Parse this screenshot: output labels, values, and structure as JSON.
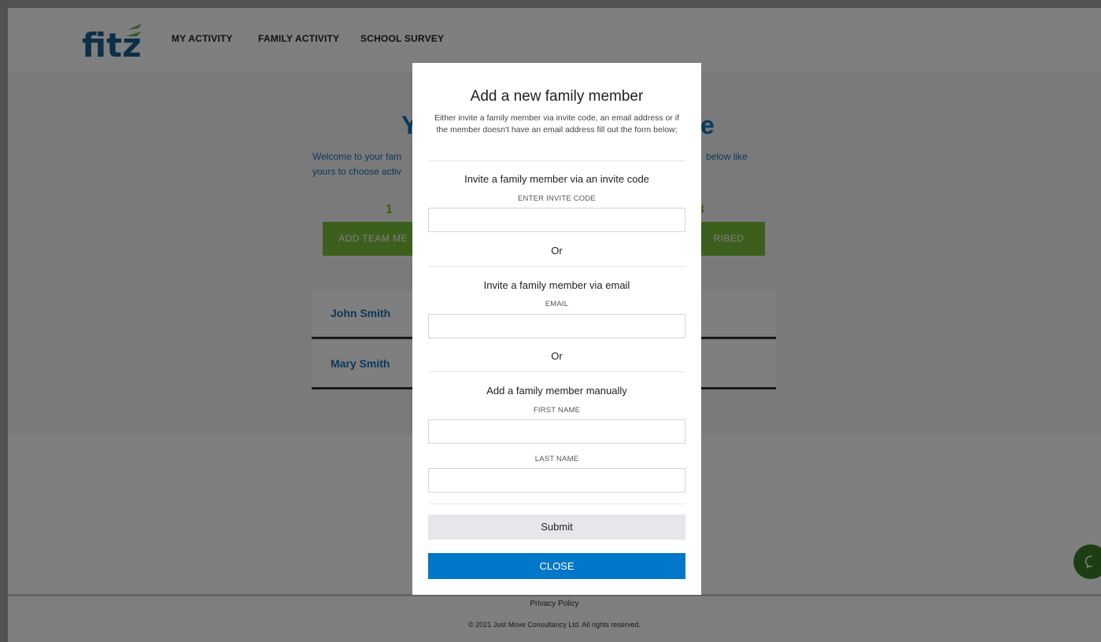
{
  "nav": {
    "logo_text": "fitz",
    "items": [
      {
        "label": "MY ACTIVITY"
      },
      {
        "label": "FAMILY ACTIVITY"
      },
      {
        "label": "SCHOOL SURVEY"
      }
    ]
  },
  "hero": {
    "title_left": "Y",
    "title_right": "e",
    "text_left_1": "Welcome to your fam",
    "text_left_2": "yours to choose activ",
    "text_right": "below like",
    "stat_left": "1",
    "stat_right": "3",
    "btn_left_label": "ADD TEAM ME",
    "btn_right_label": "RIBED"
  },
  "members": [
    {
      "name": "John Smith"
    },
    {
      "name": "Mary Smith"
    }
  ],
  "footer": {
    "privacy_label": "Privacy Policy",
    "copyright": "© 2021 Just Move Consultancy Ltd. All rights reserved."
  },
  "modal": {
    "title": "Add a new family member",
    "intro": "Either invite a family member via invite code, an email address or if the member doesn't have an email address fill out the form below;",
    "invite_code_section": "Invite a family member via an invite code",
    "invite_code_label": "ENTER INVITE CODE",
    "invite_code_value": "",
    "or_1": "Or",
    "email_section": "Invite a family member via email",
    "email_label": "EMAIL",
    "email_value": "",
    "or_2": "Or",
    "manual_section": "Add a family member manually",
    "first_name_label": "FIRST NAME",
    "first_name_value": "",
    "last_name_label": "LAST NAME",
    "last_name_value": "",
    "submit_label": "Submit",
    "close_label": "CLOSE"
  },
  "colors": {
    "brand_blue": "#1870b5",
    "brand_green": "#7bbf3b",
    "close_button": "#0077c8"
  },
  "icons": {
    "chat": "chat-bubble-icon"
  }
}
